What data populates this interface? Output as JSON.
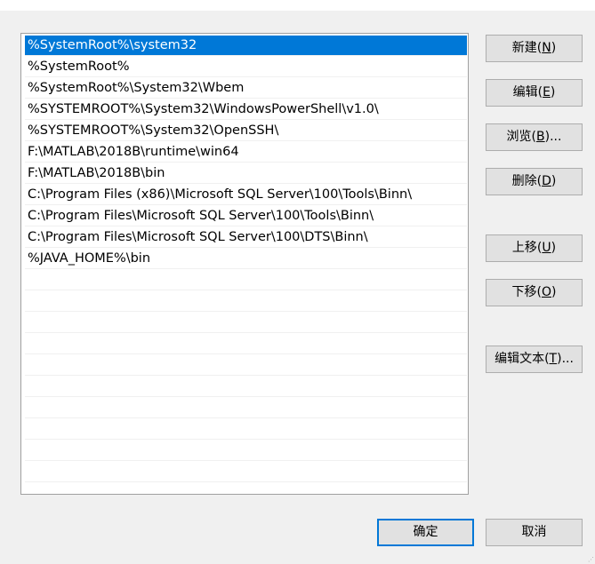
{
  "path_list": {
    "items": [
      "%SystemRoot%\\system32",
      "%SystemRoot%",
      "%SystemRoot%\\System32\\Wbem",
      "%SYSTEMROOT%\\System32\\WindowsPowerShell\\v1.0\\",
      "%SYSTEMROOT%\\System32\\OpenSSH\\",
      "F:\\MATLAB\\2018B\\runtime\\win64",
      "F:\\MATLAB\\2018B\\bin",
      "C:\\Program Files (x86)\\Microsoft SQL Server\\100\\Tools\\Binn\\",
      "C:\\Program Files\\Microsoft SQL Server\\100\\Tools\\Binn\\",
      "C:\\Program Files\\Microsoft SQL Server\\100\\DTS\\Binn\\",
      "%JAVA_HOME%\\bin"
    ],
    "selected_index": 0,
    "empty_rows": 10
  },
  "buttons": {
    "new": {
      "label": "新建(",
      "key": "N",
      "suffix": ")"
    },
    "edit": {
      "label": "编辑(",
      "key": "E",
      "suffix": ")"
    },
    "browse": {
      "label": "浏览(",
      "key": "B",
      "suffix": ")..."
    },
    "delete": {
      "label": "删除(",
      "key": "D",
      "suffix": ")"
    },
    "move_up": {
      "label": "上移(",
      "key": "U",
      "suffix": ")"
    },
    "move_down": {
      "label": "下移(",
      "key": "O",
      "suffix": ")"
    },
    "edit_text": {
      "label": "编辑文本(",
      "key": "T",
      "suffix": ")..."
    },
    "ok": "确定",
    "cancel": "取消"
  },
  "colors": {
    "selection": "#0078d7",
    "dialog_bg": "#f0f0f0",
    "button_bg": "#e1e1e1"
  }
}
